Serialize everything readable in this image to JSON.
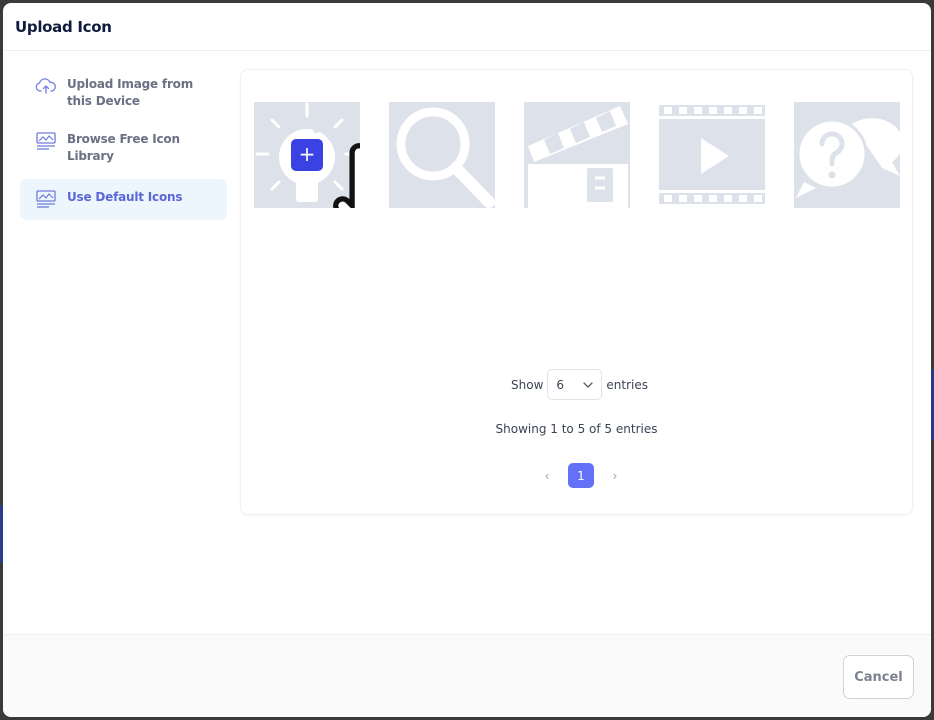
{
  "modal": {
    "title": "Upload Icon"
  },
  "sidebar": {
    "items": [
      {
        "label": "Upload Image from this Device",
        "icon": "cloud-upload-icon",
        "active": false
      },
      {
        "label": "Browse Free Icon Library",
        "icon": "image-library-icon",
        "active": false
      },
      {
        "label": "Use Default Icons",
        "icon": "image-library-icon",
        "active": true
      }
    ]
  },
  "icons": [
    {
      "name": "lightbulb-icon"
    },
    {
      "name": "magnifier-icon"
    },
    {
      "name": "clapperboard-icon"
    },
    {
      "name": "film-play-icon"
    },
    {
      "name": "question-chat-icon"
    }
  ],
  "add_button": {
    "label": "+"
  },
  "pagination": {
    "show_label": "Show",
    "page_size": "6",
    "entries_label": "entries",
    "summary": "Showing 1 to 5 of 5 entries",
    "current_page": "1",
    "prev_label": "‹",
    "next_label": "›"
  },
  "footer": {
    "cancel_label": "Cancel"
  },
  "colors": {
    "accent": "#5b67d8",
    "add_button": "#3b42e3",
    "page_active": "#6271f5",
    "icon_tile": "#dde1ea"
  }
}
